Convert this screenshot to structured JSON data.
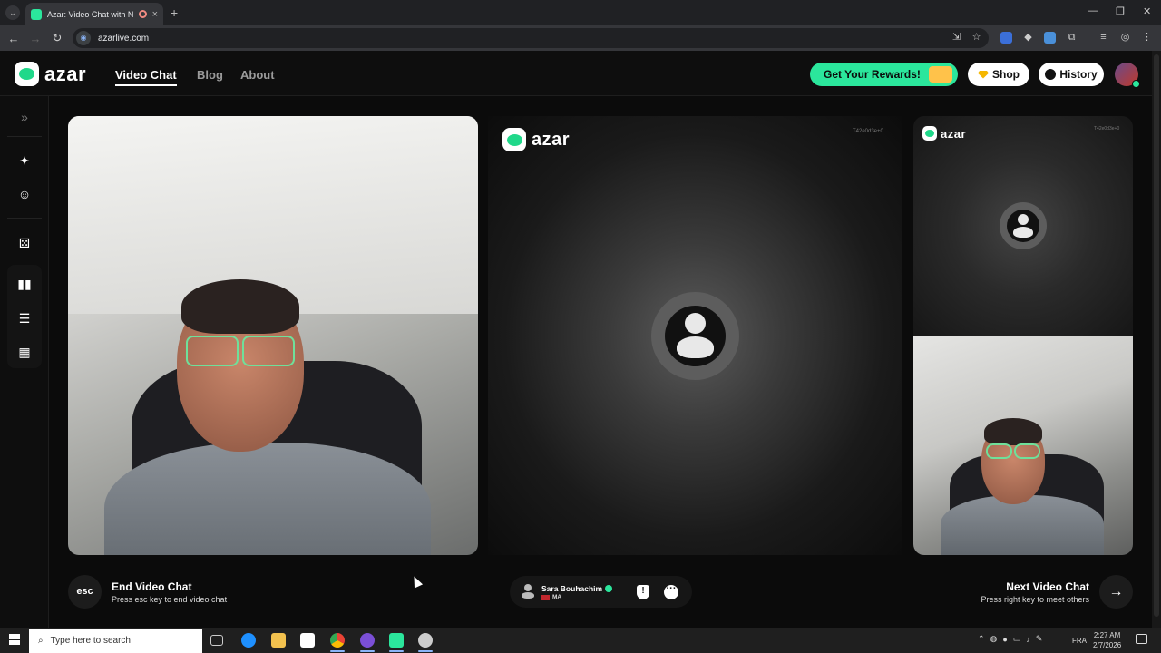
{
  "browser": {
    "tab_title": "Azar: Video Chat with New",
    "url": "azarlive.com",
    "new_tab": "+",
    "tab_close": "×"
  },
  "header": {
    "logo_text": "azar",
    "nav": [
      {
        "label": "Video Chat",
        "active": true
      },
      {
        "label": "Blog",
        "active": false
      },
      {
        "label": "About",
        "active": false
      }
    ],
    "rewards_label": "Get Your Rewards!",
    "shop_label": "Shop",
    "history_label": "History"
  },
  "sidebar": {
    "icons": [
      "expand-icon",
      "magic-wand-icon",
      "face-icon",
      "die-icon",
      "layout-side-by-side-icon",
      "layout-stacked-icon",
      "layout-grid-icon"
    ]
  },
  "remote_panel": {
    "logo_text": "azar",
    "session_id": "T42e0d3e+0"
  },
  "preview_panel": {
    "logo_text": "azar",
    "session_id": "T42e0d3e+0"
  },
  "controls": {
    "esc_key": "esc",
    "end_title": "End Video Chat",
    "end_subtitle": "Press esc key to end video chat",
    "partner_name": "Sara Bouhachim",
    "partner_country": "MA",
    "next_title": "Next Video Chat",
    "next_subtitle": "Press right key to meet others"
  },
  "taskbar": {
    "search_placeholder": "Type here to search",
    "language": "FRA",
    "time": "2:27 AM",
    "date": "2/7/2026"
  },
  "colors": {
    "brand_green": "#2be69c",
    "background": "#0b0b0b"
  }
}
